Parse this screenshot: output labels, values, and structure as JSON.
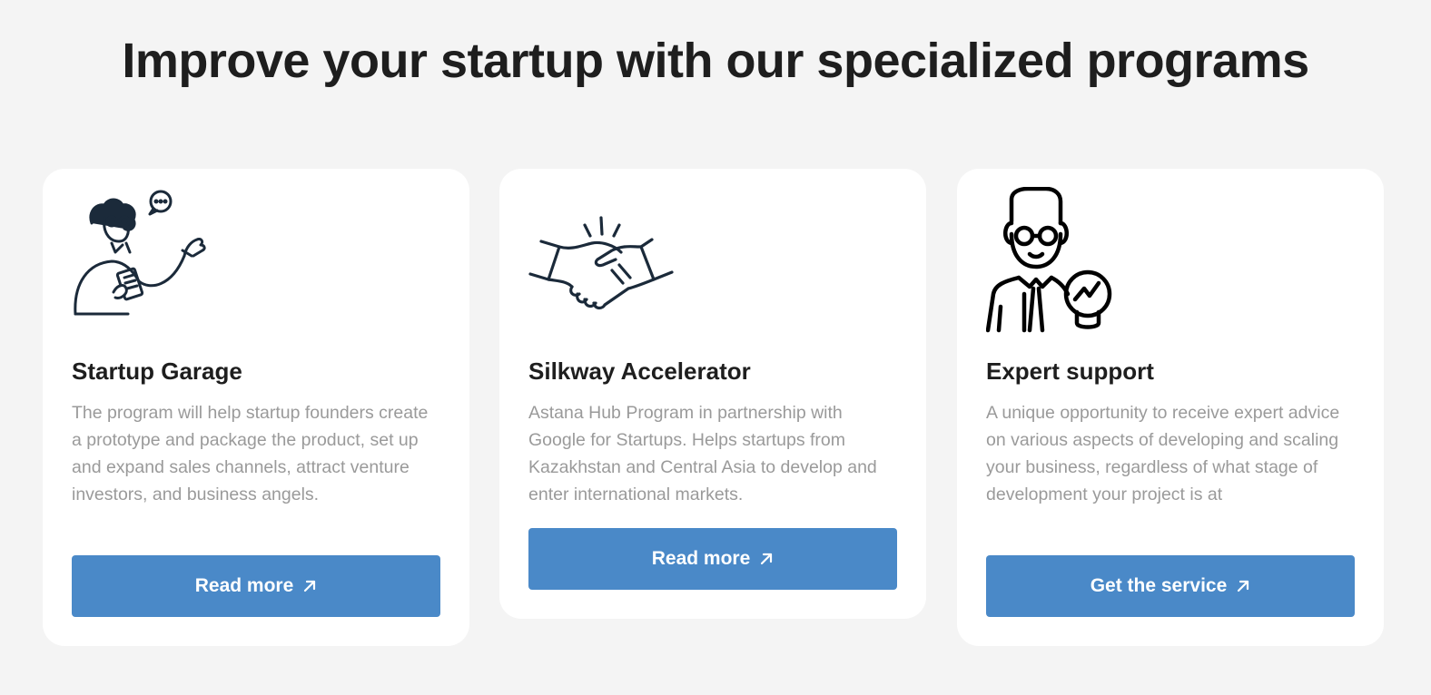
{
  "headline": "Improve your startup with our specialized programs",
  "cards": [
    {
      "title": "Startup Garage",
      "description": "The program will help startup founders create a prototype and package the product, set up and expand sales channels, attract venture investors, and business angels.",
      "button_label": "Read more",
      "illustration_icon": "person-with-notepad-icon"
    },
    {
      "title": "Silkway Accelerator",
      "description": "Astana Hub Program in partnership with Google for Startups. Helps startups from Kazakhstan and Central Asia to develop and enter international markets.",
      "button_label": "Read more",
      "illustration_icon": "handshake-icon"
    },
    {
      "title": "Expert support",
      "description": "A unique opportunity to receive expert advice on various aspects of developing and scaling your business, regardless of what stage of development your project is at",
      "button_label": "Get the service",
      "illustration_icon": "expert-lightbulb-icon"
    }
  ],
  "colors": {
    "background": "#f4f4f4",
    "card": "#ffffff",
    "accent": "#4a89c8",
    "heading": "#1e1e1e",
    "body_text": "#9a9a9a",
    "icon_stroke": "#1b2a3a"
  }
}
